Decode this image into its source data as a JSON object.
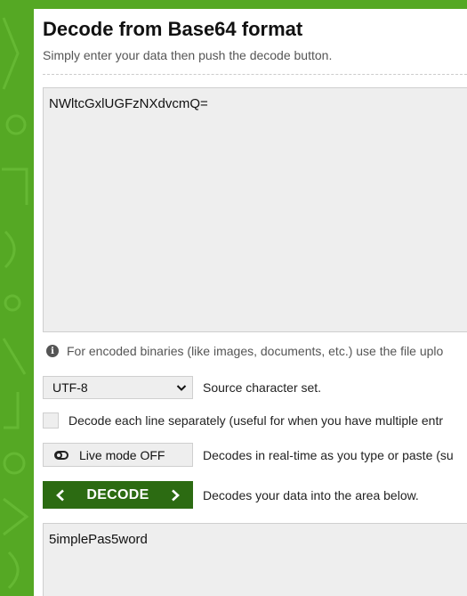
{
  "header": {
    "title": "Decode from Base64 format",
    "subtitle": "Simply enter your data then push the decode button."
  },
  "input": {
    "value": "NWltcGxlUGFzNXdvcmQ="
  },
  "info": {
    "icon": "info-icon",
    "text": "For encoded binaries (like images, documents, etc.) use the file uplo"
  },
  "charset": {
    "selected": "UTF-8",
    "label": "Source character set."
  },
  "options": {
    "decode_lines_label": "Decode each line separately (useful for when you have multiple entr",
    "live_mode_label": "Live mode OFF",
    "live_mode_desc": "Decodes in real-time as you type or paste (su"
  },
  "decode": {
    "label": "DECODE",
    "desc": "Decodes your data into the area below."
  },
  "output": {
    "value": "5implePas5word"
  },
  "colors": {
    "brand_green": "#55a824",
    "decode_button": "#2c6b12"
  }
}
